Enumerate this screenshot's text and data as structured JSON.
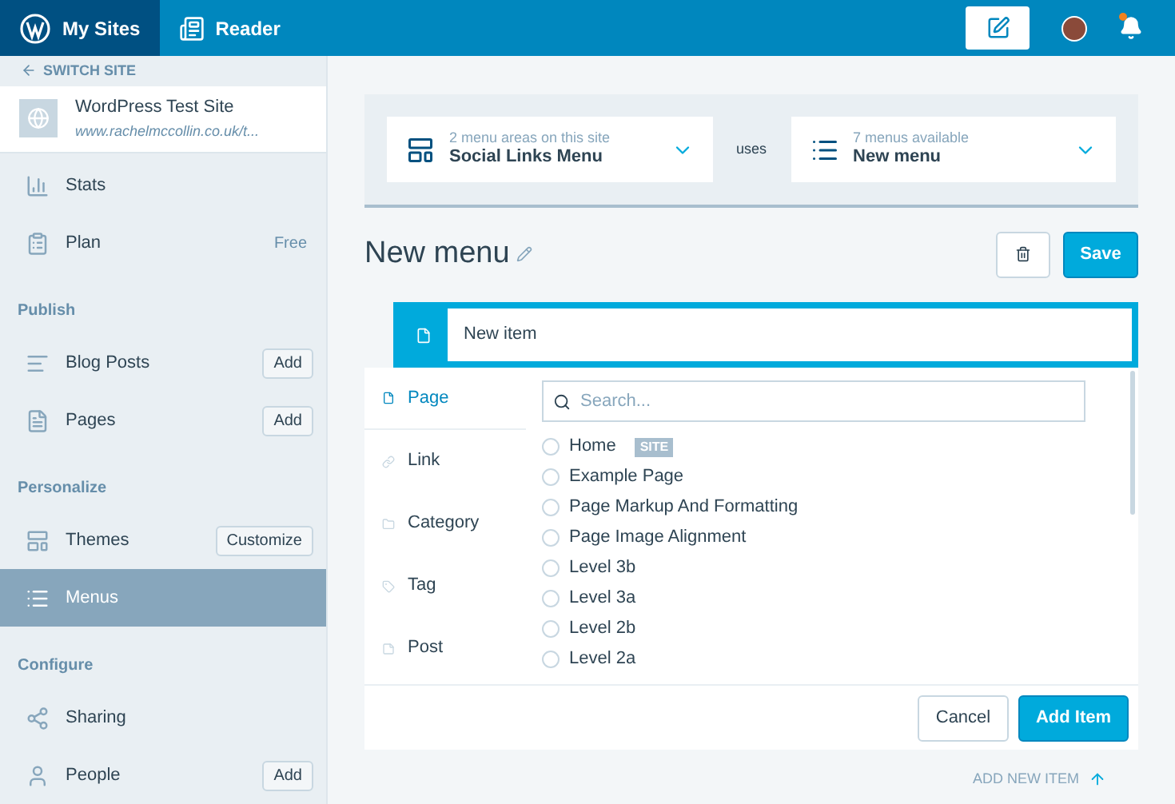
{
  "top_bar": {
    "tabs": [
      {
        "label": "My Sites",
        "selected": true,
        "kind": "sites"
      },
      {
        "label": "Reader",
        "selected": false,
        "kind": "reader"
      }
    ],
    "notifications_unread": true
  },
  "sidebar": {
    "switch_site": "SWITCH SITE",
    "site": {
      "name": "WordPress Test Site",
      "url": "www.rachelmccollin.co.uk/t..."
    },
    "items": [
      {
        "kind": "item",
        "label": "Stats",
        "selected": false
      },
      {
        "kind": "item",
        "label": "Plan",
        "note": "Free",
        "selected": false
      },
      {
        "kind": "heading",
        "label": "Publish"
      },
      {
        "kind": "item",
        "label": "Blog Posts",
        "action": "Add",
        "selected": false
      },
      {
        "kind": "item",
        "label": "Pages",
        "action": "Add",
        "selected": false
      },
      {
        "kind": "heading",
        "label": "Personalize"
      },
      {
        "kind": "item",
        "label": "Themes",
        "action": "Customize",
        "selected": false
      },
      {
        "kind": "item",
        "label": "Menus",
        "selected": true
      },
      {
        "kind": "heading",
        "label": "Configure"
      },
      {
        "kind": "item",
        "label": "Sharing",
        "selected": false
      },
      {
        "kind": "item",
        "label": "People",
        "action": "Add",
        "selected": false
      }
    ]
  },
  "location": {
    "hint": "2 menu areas on this site",
    "value": "Social Links Menu",
    "connector": "uses",
    "menu_hint": "7 menus available",
    "menu_value": "New menu"
  },
  "menu": {
    "title": "New menu",
    "save": "Save",
    "item_name": "New item"
  },
  "item_editor": {
    "types": [
      {
        "label": "Page",
        "selected": true
      },
      {
        "label": "Link",
        "selected": false
      },
      {
        "label": "Category",
        "selected": false
      },
      {
        "label": "Tag",
        "selected": false
      },
      {
        "label": "Post",
        "selected": false
      }
    ],
    "search": {
      "placeholder": "Search..."
    },
    "options": [
      {
        "label": "Home",
        "badge": "SITE",
        "checked": false
      },
      {
        "label": "Example Page",
        "checked": false
      },
      {
        "label": "Page Markup And Formatting",
        "checked": false
      },
      {
        "label": "Page Image Alignment",
        "checked": false
      },
      {
        "label": "Level 3b",
        "checked": false
      },
      {
        "label": "Level 3a",
        "checked": false
      },
      {
        "label": "Level 2b",
        "checked": false
      },
      {
        "label": "Level 2a",
        "checked": false
      }
    ],
    "cancel": "Cancel",
    "add": "Add Item"
  },
  "add_new_item": "ADD NEW ITEM"
}
